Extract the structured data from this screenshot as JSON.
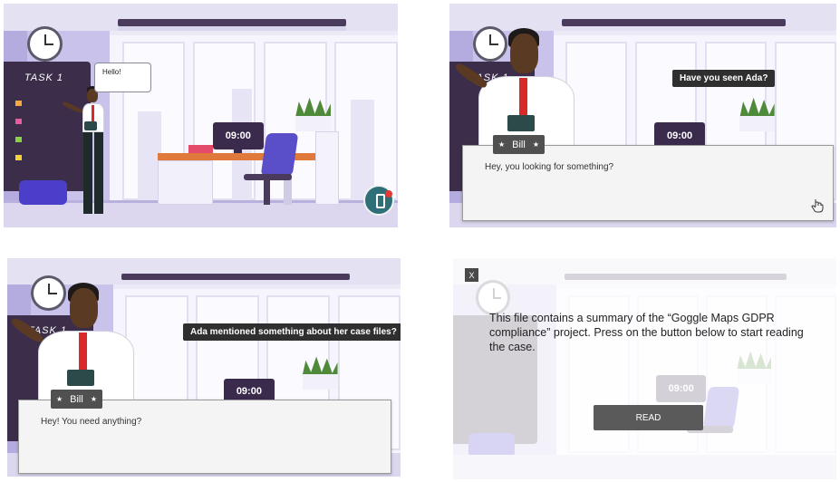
{
  "scene": {
    "monitor_time": "09:00",
    "board_title": "TASK 1",
    "colors": {
      "accent_orange": "#e07a3c",
      "chair_blue": "#5a4fc8",
      "board": "#3c2e4a",
      "phone_button": "#2f6f78",
      "notification": "#e53935"
    }
  },
  "panel1": {
    "speech": "Hello!",
    "icons": [
      "phone-icon"
    ]
  },
  "panel2": {
    "question": "Have you seen Ada?",
    "character_name": "Bill",
    "dialogue": "Hey, you looking for something?",
    "icons": [
      "hand-pointer-icon",
      "star-icon"
    ]
  },
  "panel3": {
    "question": "Ada mentioned something about her case files?",
    "character_name": "Bill",
    "dialogue": "Hey! You need anything?"
  },
  "panel4": {
    "close_label": "X",
    "description": "This file contains a summary of the “Goggle Maps GDPR compliance” project. Press on the button below to start reading the case.",
    "read_label": "READ"
  }
}
